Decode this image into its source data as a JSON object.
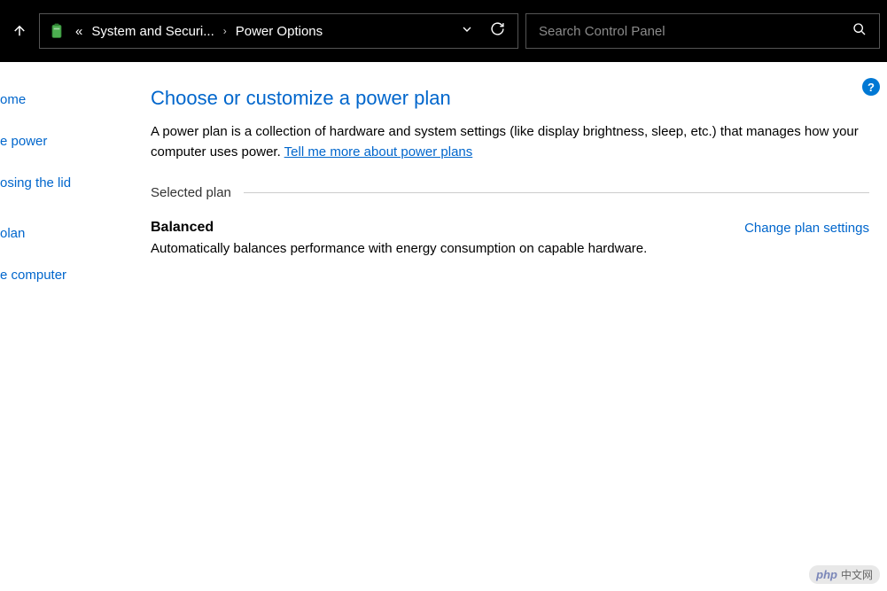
{
  "topbar": {
    "breadcrumb_prefix": "«",
    "breadcrumb_item1": "System and Securi...",
    "breadcrumb_item2": "Power Options",
    "search_placeholder": "Search Control Panel"
  },
  "sidebar": {
    "items": [
      "ome",
      "e power",
      "osing the lid",
      "olan",
      "e computer"
    ]
  },
  "main": {
    "help_badge": "?",
    "title": "Choose or customize a power plan",
    "description_part1": "A power plan is a collection of hardware and system settings (like display brightness, sleep, etc.) that manages how your computer uses power. ",
    "learn_more_link": "Tell me more about power plans",
    "section_label": "Selected plan",
    "plan": {
      "name": "Balanced",
      "description": "Automatically balances performance with energy consumption on capable hardware.",
      "change_link": "Change plan settings"
    }
  },
  "watermark": {
    "logo": "php",
    "text": "中文网"
  }
}
